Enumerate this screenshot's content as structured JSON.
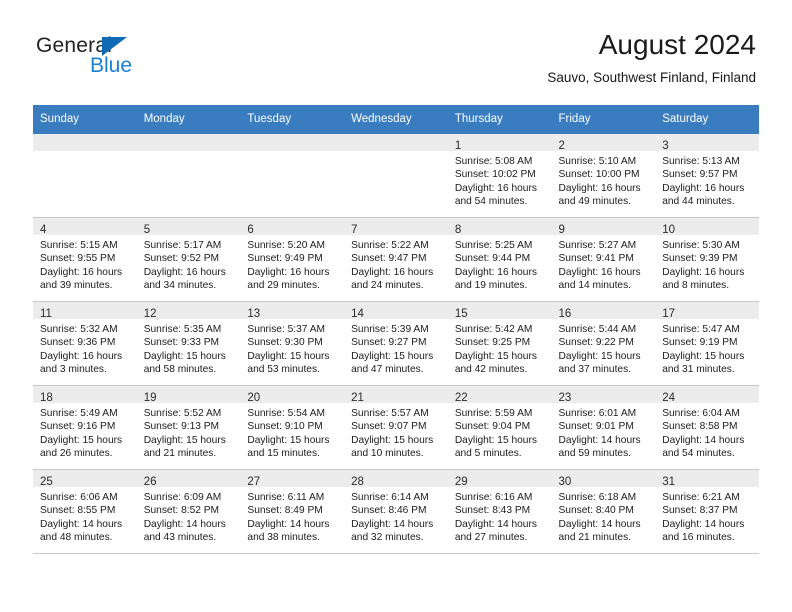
{
  "logo": {
    "word_one": "General",
    "word_two": "Blue",
    "triangle_color": "#0d6bb5",
    "blue_color": "#1b7fd4"
  },
  "header": {
    "title": "August 2024",
    "subtitle": "Sauvo, Southwest Finland, Finland"
  },
  "theme": {
    "header_bg": "#3a7cc0",
    "header_text": "#ffffff",
    "daynum_shade": "#ececec",
    "grid_line": "#c8c8c8"
  },
  "weekday_headers": [
    "Sunday",
    "Monday",
    "Tuesday",
    "Wednesday",
    "Thursday",
    "Friday",
    "Saturday"
  ],
  "labels": {
    "sunrise_prefix": "Sunrise:",
    "sunset_prefix": "Sunset:",
    "daylight_prefix": "Daylight:"
  },
  "weeks": [
    [
      {
        "day": "",
        "lines": []
      },
      {
        "day": "",
        "lines": []
      },
      {
        "day": "",
        "lines": []
      },
      {
        "day": "",
        "lines": []
      },
      {
        "day": "1",
        "lines": [
          "Sunrise: 5:08 AM",
          "Sunset: 10:02 PM",
          "Daylight: 16 hours",
          "and 54 minutes."
        ]
      },
      {
        "day": "2",
        "lines": [
          "Sunrise: 5:10 AM",
          "Sunset: 10:00 PM",
          "Daylight: 16 hours",
          "and 49 minutes."
        ]
      },
      {
        "day": "3",
        "lines": [
          "Sunrise: 5:13 AM",
          "Sunset: 9:57 PM",
          "Daylight: 16 hours",
          "and 44 minutes."
        ]
      }
    ],
    [
      {
        "day": "4",
        "lines": [
          "Sunrise: 5:15 AM",
          "Sunset: 9:55 PM",
          "Daylight: 16 hours",
          "and 39 minutes."
        ]
      },
      {
        "day": "5",
        "lines": [
          "Sunrise: 5:17 AM",
          "Sunset: 9:52 PM",
          "Daylight: 16 hours",
          "and 34 minutes."
        ]
      },
      {
        "day": "6",
        "lines": [
          "Sunrise: 5:20 AM",
          "Sunset: 9:49 PM",
          "Daylight: 16 hours",
          "and 29 minutes."
        ]
      },
      {
        "day": "7",
        "lines": [
          "Sunrise: 5:22 AM",
          "Sunset: 9:47 PM",
          "Daylight: 16 hours",
          "and 24 minutes."
        ]
      },
      {
        "day": "8",
        "lines": [
          "Sunrise: 5:25 AM",
          "Sunset: 9:44 PM",
          "Daylight: 16 hours",
          "and 19 minutes."
        ]
      },
      {
        "day": "9",
        "lines": [
          "Sunrise: 5:27 AM",
          "Sunset: 9:41 PM",
          "Daylight: 16 hours",
          "and 14 minutes."
        ]
      },
      {
        "day": "10",
        "lines": [
          "Sunrise: 5:30 AM",
          "Sunset: 9:39 PM",
          "Daylight: 16 hours",
          "and 8 minutes."
        ]
      }
    ],
    [
      {
        "day": "11",
        "lines": [
          "Sunrise: 5:32 AM",
          "Sunset: 9:36 PM",
          "Daylight: 16 hours",
          "and 3 minutes."
        ]
      },
      {
        "day": "12",
        "lines": [
          "Sunrise: 5:35 AM",
          "Sunset: 9:33 PM",
          "Daylight: 15 hours",
          "and 58 minutes."
        ]
      },
      {
        "day": "13",
        "lines": [
          "Sunrise: 5:37 AM",
          "Sunset: 9:30 PM",
          "Daylight: 15 hours",
          "and 53 minutes."
        ]
      },
      {
        "day": "14",
        "lines": [
          "Sunrise: 5:39 AM",
          "Sunset: 9:27 PM",
          "Daylight: 15 hours",
          "and 47 minutes."
        ]
      },
      {
        "day": "15",
        "lines": [
          "Sunrise: 5:42 AM",
          "Sunset: 9:25 PM",
          "Daylight: 15 hours",
          "and 42 minutes."
        ]
      },
      {
        "day": "16",
        "lines": [
          "Sunrise: 5:44 AM",
          "Sunset: 9:22 PM",
          "Daylight: 15 hours",
          "and 37 minutes."
        ]
      },
      {
        "day": "17",
        "lines": [
          "Sunrise: 5:47 AM",
          "Sunset: 9:19 PM",
          "Daylight: 15 hours",
          "and 31 minutes."
        ]
      }
    ],
    [
      {
        "day": "18",
        "lines": [
          "Sunrise: 5:49 AM",
          "Sunset: 9:16 PM",
          "Daylight: 15 hours",
          "and 26 minutes."
        ]
      },
      {
        "day": "19",
        "lines": [
          "Sunrise: 5:52 AM",
          "Sunset: 9:13 PM",
          "Daylight: 15 hours",
          "and 21 minutes."
        ]
      },
      {
        "day": "20",
        "lines": [
          "Sunrise: 5:54 AM",
          "Sunset: 9:10 PM",
          "Daylight: 15 hours",
          "and 15 minutes."
        ]
      },
      {
        "day": "21",
        "lines": [
          "Sunrise: 5:57 AM",
          "Sunset: 9:07 PM",
          "Daylight: 15 hours",
          "and 10 minutes."
        ]
      },
      {
        "day": "22",
        "lines": [
          "Sunrise: 5:59 AM",
          "Sunset: 9:04 PM",
          "Daylight: 15 hours",
          "and 5 minutes."
        ]
      },
      {
        "day": "23",
        "lines": [
          "Sunrise: 6:01 AM",
          "Sunset: 9:01 PM",
          "Daylight: 14 hours",
          "and 59 minutes."
        ]
      },
      {
        "day": "24",
        "lines": [
          "Sunrise: 6:04 AM",
          "Sunset: 8:58 PM",
          "Daylight: 14 hours",
          "and 54 minutes."
        ]
      }
    ],
    [
      {
        "day": "25",
        "lines": [
          "Sunrise: 6:06 AM",
          "Sunset: 8:55 PM",
          "Daylight: 14 hours",
          "and 48 minutes."
        ]
      },
      {
        "day": "26",
        "lines": [
          "Sunrise: 6:09 AM",
          "Sunset: 8:52 PM",
          "Daylight: 14 hours",
          "and 43 minutes."
        ]
      },
      {
        "day": "27",
        "lines": [
          "Sunrise: 6:11 AM",
          "Sunset: 8:49 PM",
          "Daylight: 14 hours",
          "and 38 minutes."
        ]
      },
      {
        "day": "28",
        "lines": [
          "Sunrise: 6:14 AM",
          "Sunset: 8:46 PM",
          "Daylight: 14 hours",
          "and 32 minutes."
        ]
      },
      {
        "day": "29",
        "lines": [
          "Sunrise: 6:16 AM",
          "Sunset: 8:43 PM",
          "Daylight: 14 hours",
          "and 27 minutes."
        ]
      },
      {
        "day": "30",
        "lines": [
          "Sunrise: 6:18 AM",
          "Sunset: 8:40 PM",
          "Daylight: 14 hours",
          "and 21 minutes."
        ]
      },
      {
        "day": "31",
        "lines": [
          "Sunrise: 6:21 AM",
          "Sunset: 8:37 PM",
          "Daylight: 14 hours",
          "and 16 minutes."
        ]
      }
    ]
  ]
}
